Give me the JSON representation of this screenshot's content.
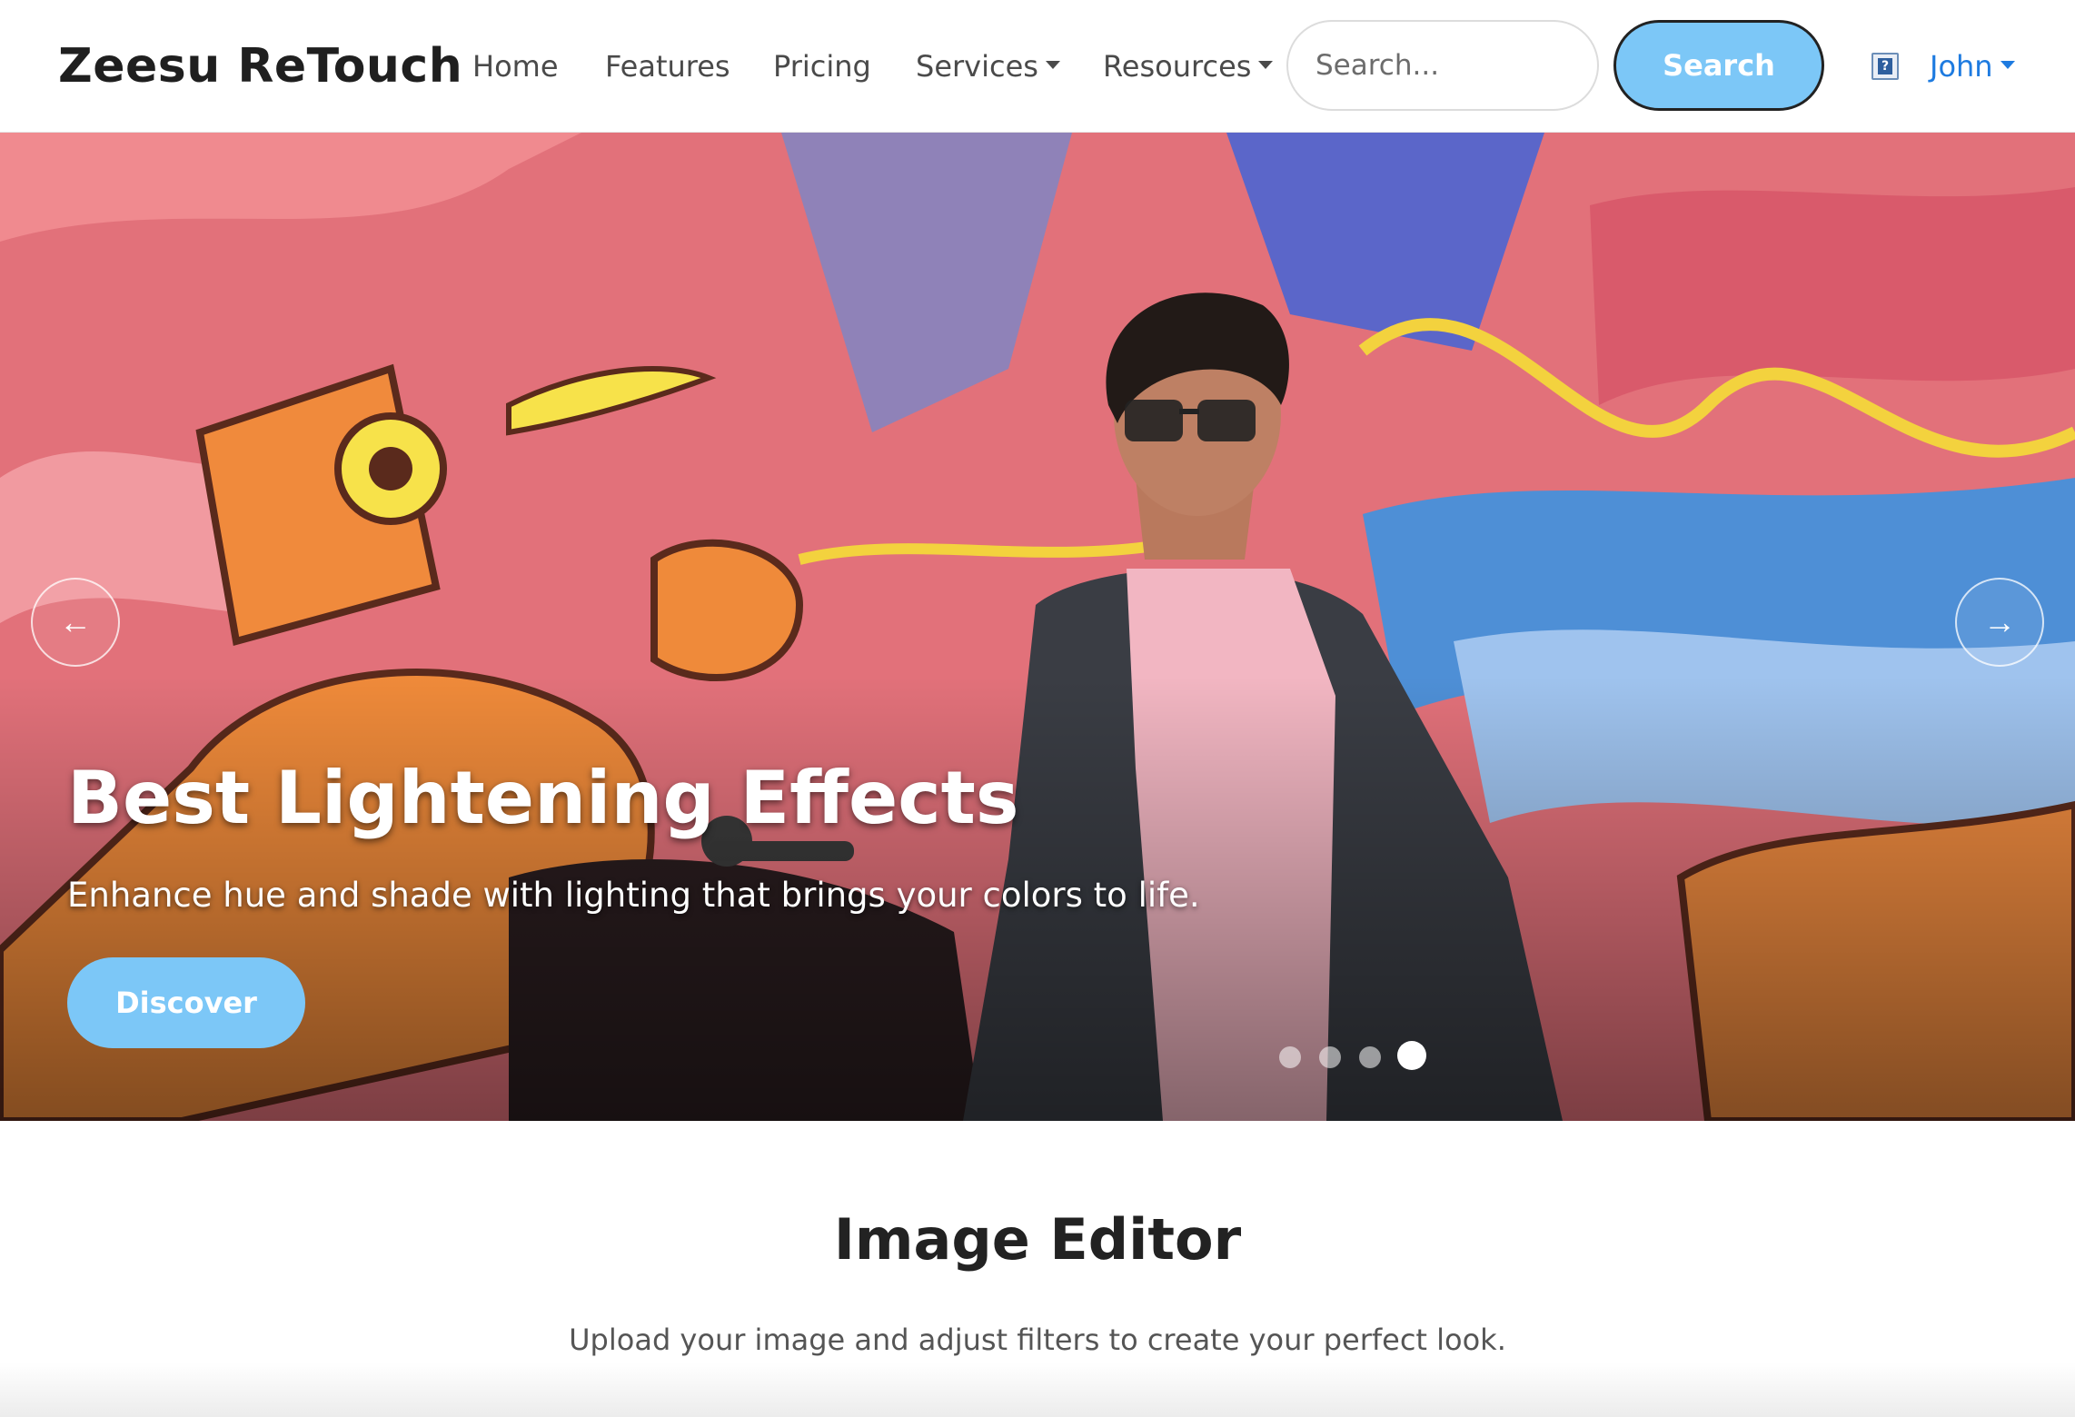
{
  "navbar": {
    "brand": "Zeesu ReTouch",
    "links": [
      {
        "label": "Home",
        "dropdown": false
      },
      {
        "label": "Features",
        "dropdown": false
      },
      {
        "label": "Pricing",
        "dropdown": false
      },
      {
        "label": "Services",
        "dropdown": true
      },
      {
        "label": "Resources",
        "dropdown": true
      }
    ],
    "search": {
      "placeholder": "Search...",
      "value": "",
      "button_label": "Search"
    },
    "help_icon": "question-icon",
    "user": {
      "name": "John",
      "dropdown": true
    },
    "colors": {
      "accent": "#7cc7f7",
      "user_link": "#1e7be0"
    }
  },
  "hero": {
    "title": "Best Lightening Effects",
    "text": "Enhance hue and shade with lighting that brings your colors to life.",
    "button_label": "Discover",
    "prev_icon": "←",
    "next_icon": "→",
    "slide_count": 4,
    "active_slide": 4
  },
  "editor": {
    "title": "Image Editor",
    "subtitle": "Upload your image and adjust filters to create your perfect look."
  }
}
